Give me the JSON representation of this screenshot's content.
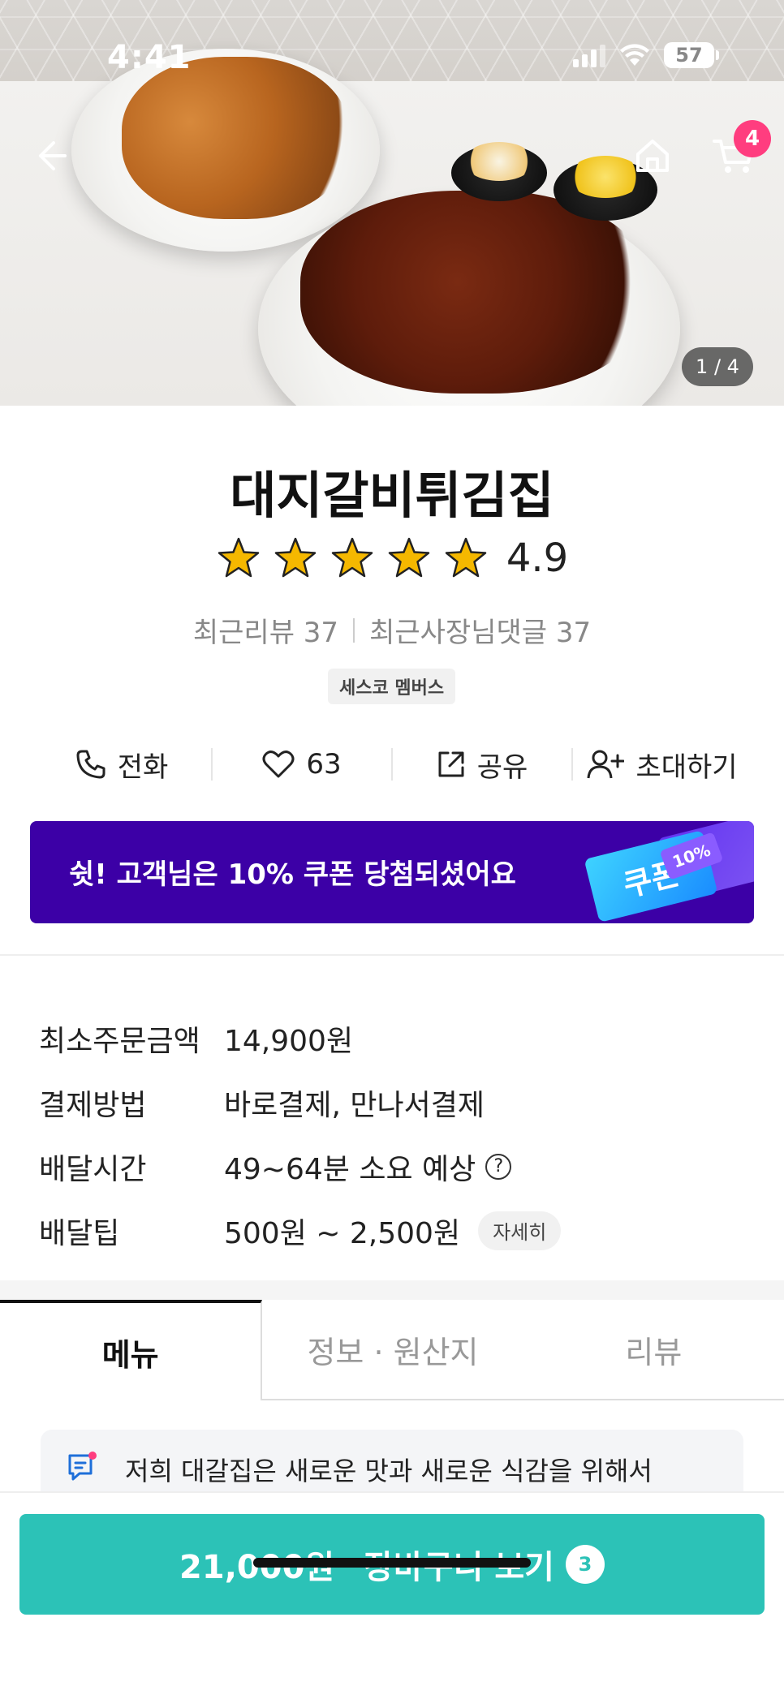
{
  "status_bar": {
    "time": "4:41",
    "battery": "57"
  },
  "hero": {
    "cart_badge": "4",
    "image_counter": "1 / 4"
  },
  "store": {
    "name": "대지갈비튀김집",
    "rating": "4.9",
    "rating_stars": 5,
    "recent_reviews": "최근리뷰 37",
    "recent_owner_replies": "최근사장님댓글 37",
    "tag": "세스코 멤버스"
  },
  "actions": {
    "call": "전화",
    "likes": "63",
    "share": "공유",
    "invite": "초대하기"
  },
  "coupon": {
    "text": "쉿! 고객님은 10% 쿠폰 당첨되셨어요",
    "ticket_label": "쿠폰",
    "ticket_percent": "10%"
  },
  "info": {
    "min_order_label": "최소주문금액",
    "min_order_value": "14,900원",
    "payment_label": "결제방법",
    "payment_value": "바로결제, 만나서결제",
    "delivery_time_label": "배달시간",
    "delivery_time_value": "49~64분 소요 예상",
    "delivery_tip_label": "배달팁",
    "delivery_tip_value": "500원 ~ 2,500원",
    "detail_chip": "자세히"
  },
  "tabs": [
    {
      "label": "메뉴"
    },
    {
      "label": "정보 · 원산지"
    },
    {
      "label": "리뷰"
    }
  ],
  "notice": {
    "text": "저희 대갈집은 새로운 맛과 새로운 식감을 위해서"
  },
  "bottom": {
    "price": "21,000원",
    "cart_label": "장바구니 보기",
    "cart_count": "3"
  },
  "colors": {
    "accent": "#2cc2b7",
    "coupon_bg": "#3c00a6",
    "badge": "#ff3d7f",
    "star": "#f5b800"
  }
}
